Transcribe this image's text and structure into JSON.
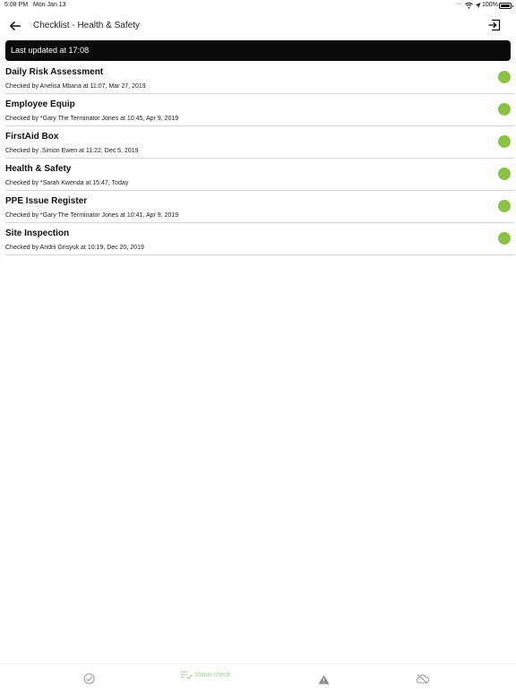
{
  "status_bar": {
    "time": "5:08 PM",
    "date": "Mon Jan 13",
    "battery": "100%"
  },
  "header": {
    "title": "Checklist  - Health & Safety"
  },
  "banner": {
    "text": "Last updated at 17:08"
  },
  "checklist": {
    "status_color": "#8bc34a",
    "items": [
      {
        "title": "Daily Risk Assessment",
        "checked": "Checked by Anelisa Mbana at 11:07, Mar 27, 2019",
        "status_icon": "green-status-dot"
      },
      {
        "title": "Employee Equip",
        "checked": "Checked by *Gary The Terminator Jones at 10:45, Apr 9, 2019",
        "status_icon": "green-status-dot"
      },
      {
        "title": "FirstAid Box",
        "checked": "Checked by .Simon Ewen at 11:22, Dec 5, 2019",
        "status_icon": "green-status-dot"
      },
      {
        "title": "Health & Safety",
        "checked": "Checked by *Sarah Kwenda at 15:47, Today",
        "status_icon": "green-status-dot"
      },
      {
        "title": "PPE Issue Register",
        "checked": "Checked by *Gary The Terminator Jones at 10:41, Apr 9, 2019",
        "status_icon": "green-status-dot"
      },
      {
        "title": "Site Inspection",
        "checked": "Checked by Andrii Grisyuk at 10:19, Dec 20, 2019",
        "status_icon": "green-status-dot"
      }
    ]
  },
  "tabbar": {
    "tabs": [
      {
        "icon": "check-circle-icon",
        "label": ""
      },
      {
        "icon": "status-check-icon",
        "label": "Status check",
        "active": true
      },
      {
        "icon": "warning-icon",
        "label": ""
      },
      {
        "icon": "cloud-off-icon",
        "label": ""
      }
    ],
    "active_color": "#a9c99a",
    "inactive_color": "#9a9a9a"
  }
}
